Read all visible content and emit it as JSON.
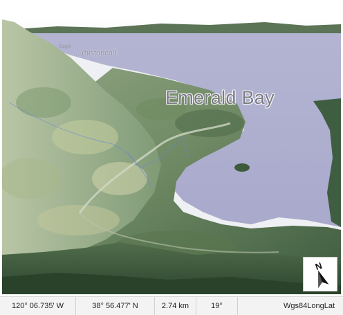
{
  "map": {
    "labels": {
      "main": "Emerald Bay",
      "minor": "... (historical)",
      "tiny": "Eagle"
    },
    "colors": {
      "water": "#aeaed0",
      "forest_dark": "#2f4a33",
      "forest_mid": "#59744f",
      "forest_light": "#9fb089",
      "sky": "#ffffff"
    },
    "compass": {
      "letter": "N",
      "icon": "north-arrow-icon"
    }
  },
  "status_bar": {
    "longitude": "120° 06.735' W",
    "latitude": "38° 56.477' N",
    "altitude": "2.74 km",
    "tilt": "19°",
    "coordinate_system": "Wgs84LongLat"
  }
}
